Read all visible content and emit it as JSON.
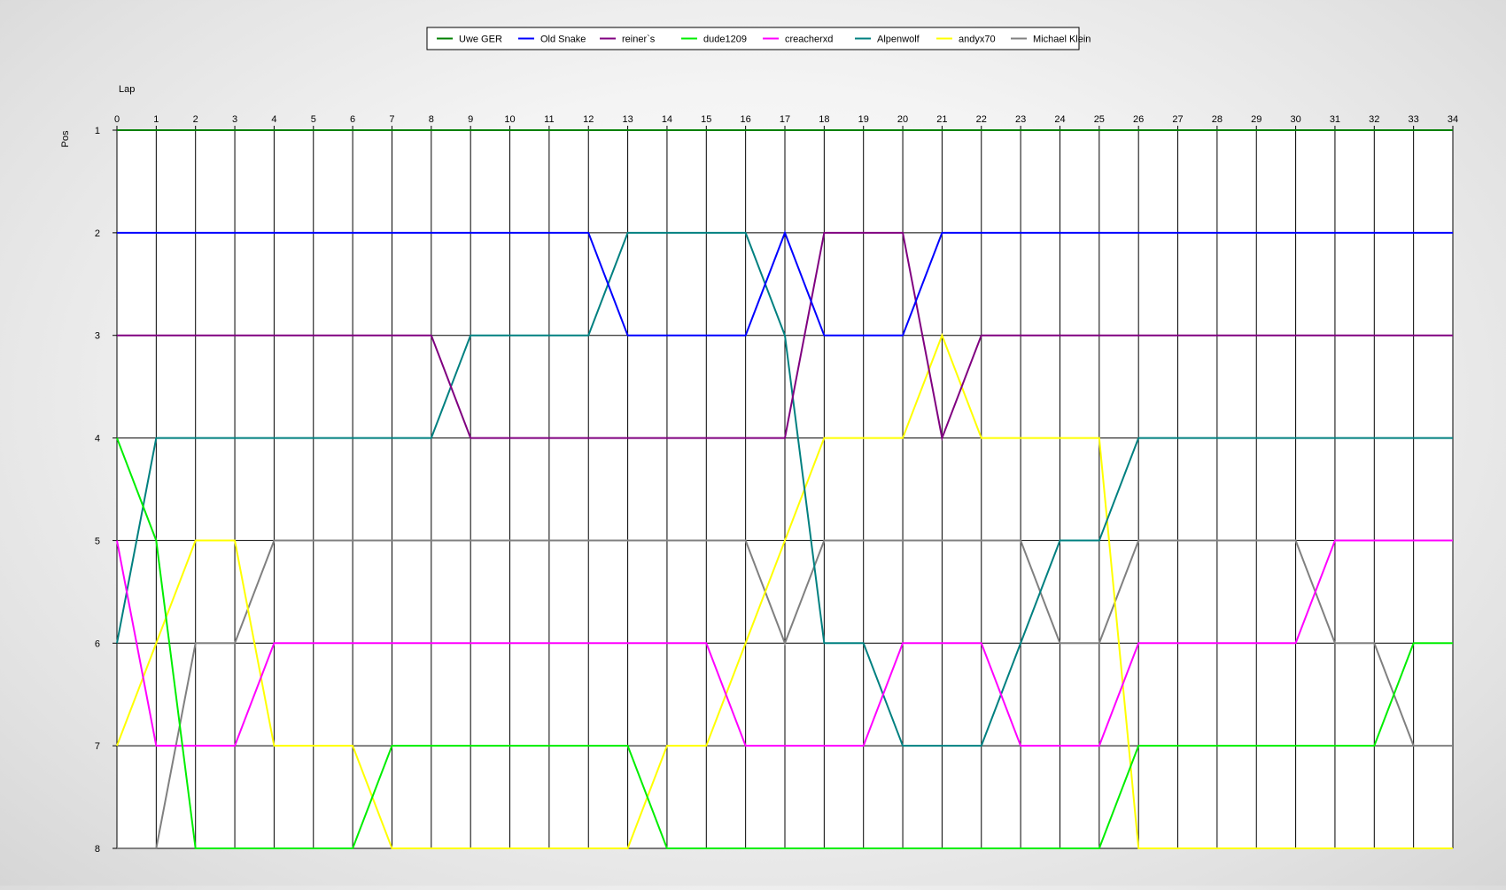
{
  "chart_data": {
    "type": "line",
    "xlabel": "Lap",
    "ylabel": "Pos",
    "xlim": [
      0,
      34
    ],
    "ylim": [
      1,
      8
    ],
    "y_inverted": true,
    "grid": true,
    "legend_position": "top-center",
    "x": [
      0,
      1,
      2,
      3,
      4,
      5,
      6,
      7,
      8,
      9,
      10,
      11,
      12,
      13,
      14,
      15,
      16,
      17,
      18,
      19,
      20,
      21,
      22,
      23,
      24,
      25,
      26,
      27,
      28,
      29,
      30,
      31,
      32,
      33,
      34
    ],
    "y_ticks": [
      1,
      2,
      3,
      4,
      5,
      6,
      7,
      8
    ],
    "series": [
      {
        "name": "Uwe GER",
        "color": "#008000",
        "values": [
          1,
          1,
          1,
          1,
          1,
          1,
          1,
          1,
          1,
          1,
          1,
          1,
          1,
          1,
          1,
          1,
          1,
          1,
          1,
          1,
          1,
          1,
          1,
          1,
          1,
          1,
          1,
          1,
          1,
          1,
          1,
          1,
          1,
          1,
          1
        ]
      },
      {
        "name": "Old Snake",
        "color": "#0000ff",
        "values": [
          2,
          2,
          2,
          2,
          2,
          2,
          2,
          2,
          2,
          2,
          2,
          2,
          2,
          3,
          3,
          3,
          3,
          2,
          3,
          3,
          3,
          2,
          2,
          2,
          2,
          2,
          2,
          2,
          2,
          2,
          2,
          2,
          2,
          2,
          2
        ]
      },
      {
        "name": "reiner`s",
        "color": "#800080",
        "values": [
          3,
          3,
          3,
          3,
          3,
          3,
          3,
          3,
          3,
          4,
          4,
          4,
          4,
          4,
          4,
          4,
          4,
          4,
          2,
          2,
          2,
          4,
          3,
          3,
          3,
          3,
          3,
          3,
          3,
          3,
          3,
          3,
          3,
          3,
          3
        ]
      },
      {
        "name": "dude1209",
        "color": "#00ee00",
        "values": [
          4,
          5,
          8,
          8,
          8,
          8,
          8,
          7,
          7,
          7,
          7,
          7,
          7,
          7,
          8,
          8,
          8,
          8,
          8,
          8,
          8,
          8,
          8,
          8,
          8,
          8,
          7,
          7,
          7,
          7,
          7,
          7,
          7,
          6,
          6
        ]
      },
      {
        "name": "creacherxd",
        "color": "#ff00ff",
        "values": [
          5,
          7,
          7,
          7,
          6,
          6,
          6,
          6,
          6,
          6,
          6,
          6,
          6,
          6,
          6,
          6,
          7,
          7,
          7,
          7,
          6,
          6,
          6,
          7,
          7,
          7,
          6,
          6,
          6,
          6,
          6,
          5,
          5,
          5,
          5
        ]
      },
      {
        "name": "Alpenwolf",
        "color": "#008080",
        "values": [
          6,
          4,
          4,
          4,
          4,
          4,
          4,
          4,
          4,
          3,
          3,
          3,
          3,
          2,
          2,
          2,
          2,
          3,
          6,
          6,
          7,
          7,
          7,
          6,
          5,
          5,
          4,
          4,
          4,
          4,
          4,
          4,
          4,
          4,
          4
        ]
      },
      {
        "name": "andyx70",
        "color": "#ffff00",
        "values": [
          7,
          6,
          5,
          5,
          7,
          7,
          7,
          8,
          8,
          8,
          8,
          8,
          8,
          8,
          7,
          7,
          6,
          5,
          4,
          4,
          4,
          3,
          4,
          4,
          4,
          4,
          8,
          8,
          8,
          8,
          8,
          8,
          8,
          8,
          8
        ]
      },
      {
        "name": "Michael Klein",
        "color": "#808080",
        "values": [
          8,
          8,
          6,
          6,
          5,
          5,
          5,
          5,
          5,
          5,
          5,
          5,
          5,
          5,
          5,
          5,
          5,
          6,
          5,
          5,
          5,
          5,
          5,
          5,
          6,
          6,
          5,
          5,
          5,
          5,
          5,
          6,
          6,
          7,
          7
        ]
      }
    ]
  }
}
